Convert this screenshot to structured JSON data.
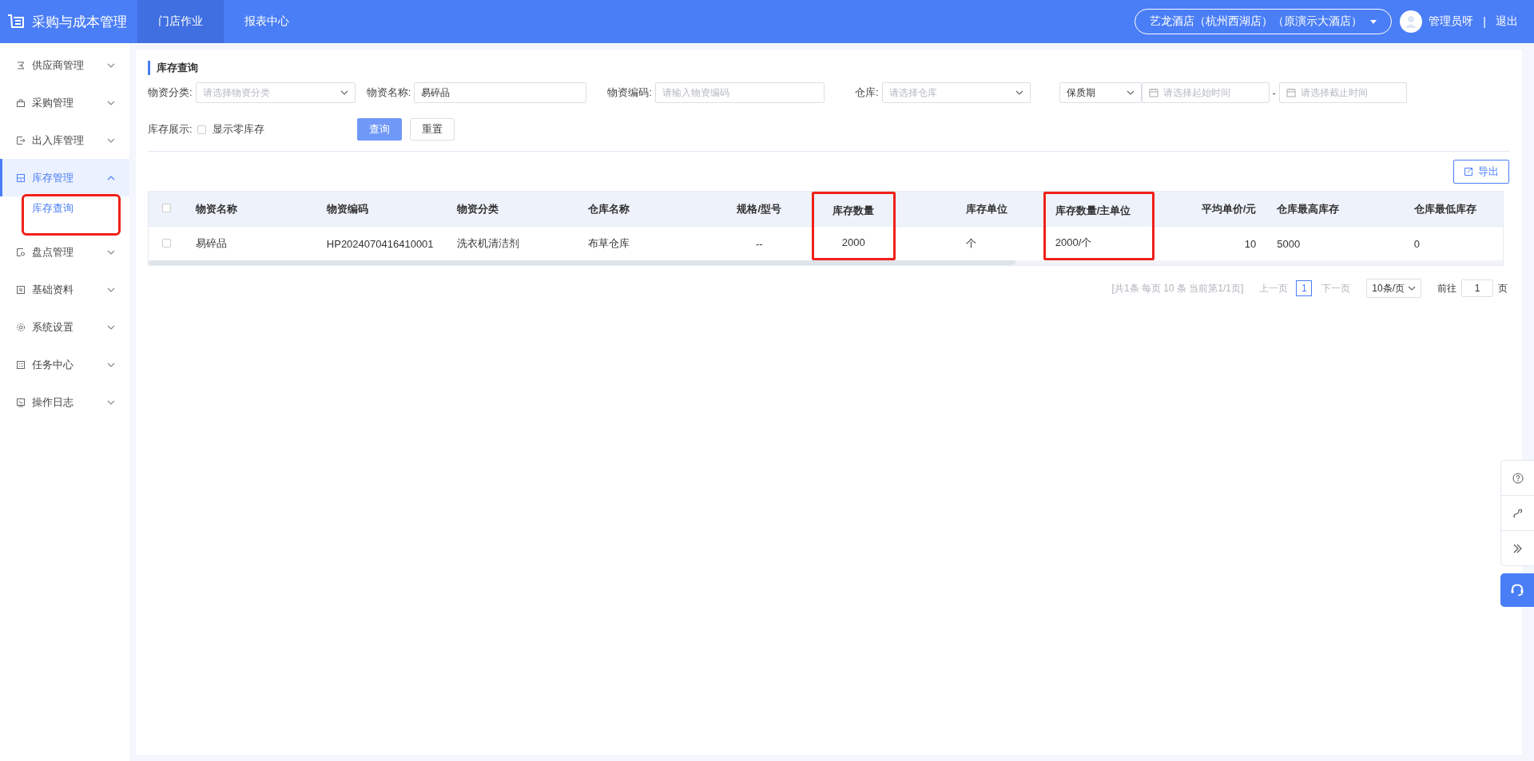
{
  "app": {
    "title": "采购与成本管理"
  },
  "top_nav": [
    {
      "label": "门店作业",
      "selected": true
    },
    {
      "label": "报表中心",
      "selected": false
    }
  ],
  "store_selector": {
    "value": "艺龙酒店（杭州西湖店）（原演示大酒店）"
  },
  "user": {
    "name": "管理员呀",
    "separator": "|",
    "logout": "退出"
  },
  "sidebar": {
    "items": [
      {
        "label": "供应商管理",
        "expanded": false,
        "selected": false
      },
      {
        "label": "采购管理",
        "expanded": false,
        "selected": false
      },
      {
        "label": "出入库管理",
        "expanded": false,
        "selected": false
      },
      {
        "label": "库存管理",
        "expanded": true,
        "selected": true,
        "children": [
          {
            "label": "库存查询",
            "selected": true,
            "highlighted": true
          }
        ]
      },
      {
        "label": "盘点管理",
        "expanded": false,
        "selected": false
      },
      {
        "label": "基础资料",
        "expanded": false,
        "selected": false
      },
      {
        "label": "系统设置",
        "expanded": false,
        "selected": false
      },
      {
        "label": "任务中心",
        "expanded": false,
        "selected": false
      },
      {
        "label": "操作日志",
        "expanded": false,
        "selected": false
      }
    ]
  },
  "page_title": "库存查询",
  "filters": [
    {
      "label": "物资分类:",
      "kind": "select",
      "placeholder": "请选择物资分类"
    },
    {
      "label": "物资名称:",
      "kind": "input",
      "value": "易碎品"
    },
    {
      "label": "物资编码:",
      "kind": "input",
      "placeholder": "请输入物资编码"
    },
    {
      "label": "仓库:",
      "kind": "select",
      "placeholder": "请选择仓库"
    }
  ],
  "date_filter": {
    "type_value": "保质期",
    "start_placeholder": "请选择起始时间",
    "separator": "-",
    "end_placeholder": "请选择截止时间"
  },
  "stock_display": {
    "label": "库存展示:",
    "option": "显示零库存",
    "checked": false
  },
  "buttons": {
    "query": "查询",
    "reset": "重置"
  },
  "export_button": "导出",
  "table": {
    "select_all": false,
    "columns": [
      {
        "label": "物资名称",
        "highlighted": false
      },
      {
        "label": "物资编码",
        "highlighted": false
      },
      {
        "label": "物资分类",
        "highlighted": false
      },
      {
        "label": "仓库名称",
        "highlighted": false
      },
      {
        "label": "规格/型号",
        "highlighted": false
      },
      {
        "label": "库存数量",
        "highlighted": true
      },
      {
        "label": "库存单位",
        "highlighted": false
      },
      {
        "label": "库存数量/主单位",
        "highlighted": true
      },
      {
        "label": "平均单价/元",
        "highlighted": false
      },
      {
        "label": "仓库最高库存",
        "highlighted": false
      },
      {
        "label": "仓库最低库存",
        "highlighted": false
      }
    ],
    "rows": [
      {
        "selected": false,
        "cells": [
          "易碎品",
          "HP2024070416410001",
          "洗衣机清洁剂",
          "布草仓库",
          "--",
          "2000",
          "个",
          "2000/个",
          "10",
          "5000",
          "0"
        ]
      }
    ]
  },
  "pagination": {
    "summary": "[共1条 每页 10 条 当前第1/1页]",
    "prev": "上一页",
    "pages": [
      {
        "label": "1",
        "selected": true
      }
    ],
    "next": "下一页",
    "page_size": "10条/页",
    "goto_label": "前往",
    "goto_value": "1",
    "goto_suffix": "页"
  }
}
